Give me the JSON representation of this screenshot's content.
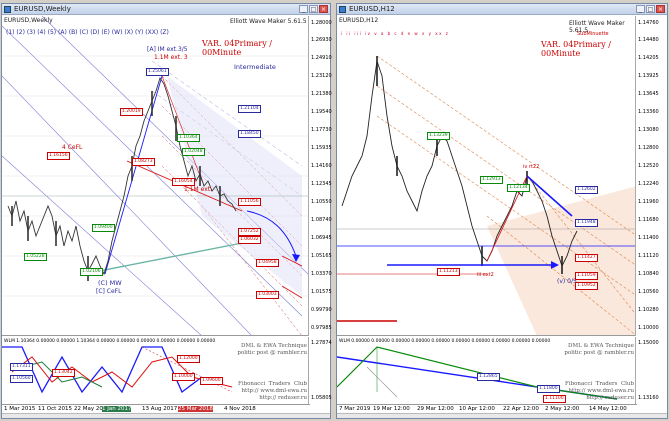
{
  "left": {
    "window_title": "EURUSD,Weekly",
    "symbol_label": "EURUSD,Weekly",
    "ewm_label": "Elliott Wave Maker 5.61.5",
    "wave_labels": "(1)  (2)  (3)  (4)  (5)  (A)  (B)  (C)  (D)  (E)  (W)  (X)  (Y)  (XX)  (Z)",
    "variant_label": "VAR. 04Primary / 00Minute",
    "intermediate": "Intermediate",
    "imext": "[A] IM ext.3/5",
    "ime3": "1.1M ext. 3",
    "cmw": "(C) MW",
    "cfl": "[C] CeFL",
    "cfl4": "4 CeFL",
    "ime3b": "1.1M ext.",
    "price_boxes": [
      "1.25061",
      "1.21104",
      "1.18450",
      "1.20019",
      "1.16156",
      "1.11056",
      "1.10364",
      "1.08273",
      "1.07252",
      "1.06032",
      "1.04958",
      "1.03003",
      "1.02000",
      "1.01100",
      "1.00000",
      "1.16054",
      "1.09400",
      "1.05228",
      "1.02106",
      "1.02048"
    ],
    "y_axis": [
      "1.28000",
      "1.26930",
      "1.24910",
      "1.23120",
      "1.21380",
      "1.19540",
      "1.17730",
      "1.15935",
      "1.14160",
      "1.12345",
      "1.10550",
      "1.08740",
      "1.06945",
      "1.05165",
      "1.03370",
      "1.01575",
      "0.99790",
      "0.97985"
    ],
    "x_axis": [
      "1 Mar 2015",
      "11 Oct 2015",
      "22 May 2016",
      "1 Jan 2017",
      "13 Aug 2017",
      "25 Mar 2018",
      "4 Nov 2018"
    ],
    "ind_label": "WLM 1.10364 0.00000 0.00000 1.10364 0.00000 0.00000 0.00000 0.00000 0.00000 0.00000",
    "ind_axis": [
      "1.27874",
      "1.05805"
    ],
    "tech_text": "DML & EWA Technique\npolitic post @ rambler.ru",
    "club_text": "Fibonacci  Traders  Club\nhttp:// www.dml-ewa.ru\nhttp:// reduser.ru",
    "ind_boxes": [
      "1.17311",
      "1.10560",
      "1.10059",
      "1.13042",
      "1.12000",
      "1.10000",
      "1.09600",
      "1.08500"
    ]
  },
  "right": {
    "window_title": "EURUSD,H12",
    "symbol_label": "EURUSD,H12",
    "ewm_label": "Elliott Wave Maker 5.61.5",
    "wave_labels": "i  ii  iii  iv  v  a  b  c  d  e  w  x  y  xx  z",
    "subminuette": "SubMinuette",
    "variant_label": "VAR. 04Primary / 00Minute",
    "iv_label": "iv rt22",
    "v_label": "(v) 0/5",
    "ext_label": "iii ext2",
    "price_boxes": [
      "1.13239",
      "1.12913",
      "1.12602",
      "1.12134",
      "1.11948",
      "1.11427",
      "1.11213",
      "1.11059",
      "1.10952",
      "1.10800",
      "1.11100",
      "1.10500"
    ],
    "y_axis": [
      "1.14760",
      "1.14480",
      "1.14205",
      "1.13925",
      "1.13645",
      "1.13360",
      "1.13080",
      "1.12800",
      "1.12520",
      "1.12240",
      "1.11960",
      "1.11680",
      "1.11400",
      "1.11120",
      "1.10840",
      "1.10560",
      "1.10280",
      "1.10000"
    ],
    "x_axis": [
      "7 Mar 2019",
      "19 Mar 12:00",
      "29 Mar 12:00",
      "10 Apr 12:00",
      "22 Apr 12:00",
      "2 May 12:00",
      "14 May 12:00"
    ],
    "ind_label": "WLM 0.00000 0.00000 0.00000 0.00000 0.00000 0.00000 0.00000 0.00000 0.00000 0.00000",
    "ind_axis": [
      "1.15000",
      "1.13160"
    ],
    "tech_text": "DML & EWA Technique\npolitic post @ rambler.ru",
    "club_text": "Fibonacci  Traders  Club\nhttp:// www.dml-ewa.ru\nhttp:// reduser.ru",
    "ind_boxes": [
      "1.12865",
      "1.11800",
      "1.11100"
    ]
  },
  "colors": {
    "bull": "#1a1aff",
    "bear": "#d11",
    "fib": "#c44",
    "green": "#0a8a0a",
    "teal": "#6ab5a4",
    "orange": "#e0844a"
  }
}
